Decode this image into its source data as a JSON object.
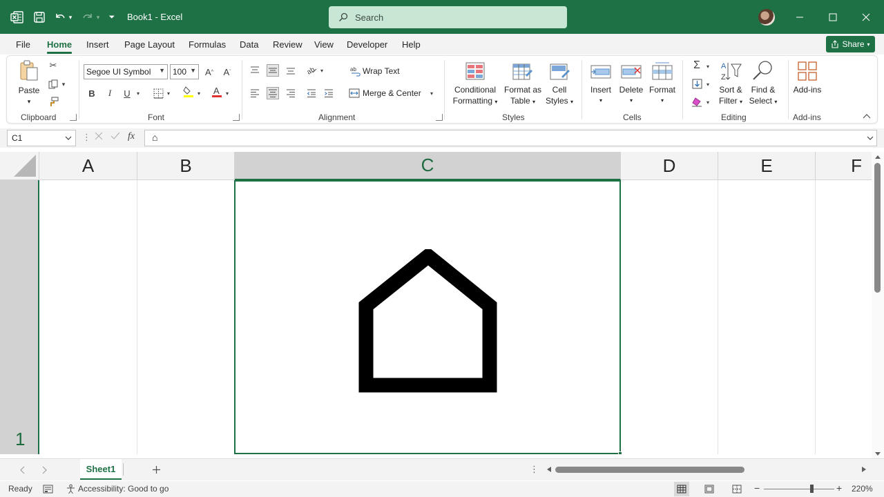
{
  "app": {
    "doc_title": "Book1 - Excel",
    "search_placeholder": "Search",
    "share_label": "Share"
  },
  "menu": {
    "tabs": [
      "File",
      "Home",
      "Insert",
      "Page Layout",
      "Formulas",
      "Data",
      "Review",
      "View",
      "Developer",
      "Help"
    ],
    "active": "Home"
  },
  "ribbon": {
    "clipboard": {
      "paste": "Paste",
      "label": "Clipboard"
    },
    "font": {
      "name": "Segoe UI Symbol",
      "size": "100",
      "bold": "B",
      "italic": "I",
      "underline": "U",
      "label": "Font"
    },
    "alignment": {
      "wrap_text": "Wrap Text",
      "merge_center": "Merge & Center",
      "label": "Alignment"
    },
    "styles": {
      "conditional_1": "Conditional",
      "conditional_2": "Formatting",
      "format_table_1": "Format as",
      "format_table_2": "Table",
      "cell_styles_1": "Cell",
      "cell_styles_2": "Styles",
      "label": "Styles"
    },
    "cells": {
      "insert": "Insert",
      "delete": "Delete",
      "format": "Format",
      "label": "Cells"
    },
    "editing": {
      "sort_1": "Sort &",
      "sort_2": "Filter",
      "find_1": "Find &",
      "find_2": "Select",
      "label": "Editing"
    },
    "addins": {
      "button": "Add-ins",
      "label": "Add-ins"
    }
  },
  "formula_bar": {
    "name_box": "C1",
    "fx": "fx",
    "content": "⌂"
  },
  "grid": {
    "columns": [
      "A",
      "B",
      "C",
      "D",
      "E",
      "F"
    ],
    "selected_column": "C",
    "row": "1",
    "cell_c1_value": "⌂"
  },
  "sheets": {
    "active": "Sheet1"
  },
  "status": {
    "ready": "Ready",
    "accessibility": "Accessibility: Good to go",
    "zoom": "220%"
  },
  "colors": {
    "accent": "#1e7145",
    "search_bg": "#c8e6d4"
  }
}
